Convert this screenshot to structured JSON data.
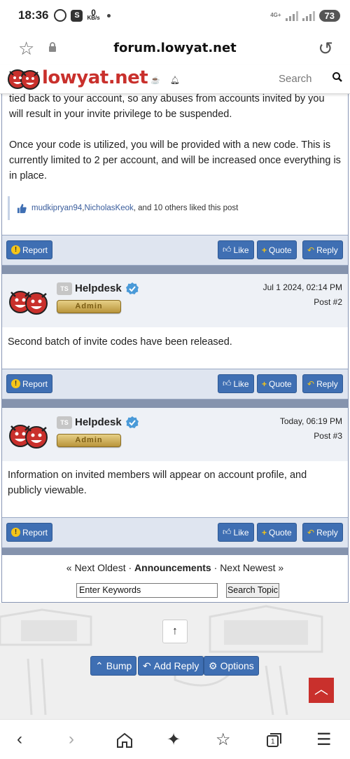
{
  "status_bar": {
    "time": "18:36",
    "kbs_value": "0",
    "kbs_unit": "KB/s",
    "network": "4G+",
    "battery": "73"
  },
  "browser": {
    "url": "forum.lowyat.net",
    "icons": [
      "star-icon",
      "lock-icon",
      "reload-icon"
    ]
  },
  "site_header": {
    "logo_text": "lowyat.net",
    "search_placeholder": "Search"
  },
  "post1_tail": {
    "paragraph1": "tied back to your account, so any abuses from accounts invited by you will result in your invite privilege to be suspended.",
    "paragraph2": "Once your code is utilized, you will be provided with a new code. This is currently limited to 2 per account, and will be increased once everything is in place.",
    "liker1": "mudkipryan94",
    "comma": ", ",
    "liker2": "NicholasKeok",
    "likes_rest": ", and 10 others liked this post"
  },
  "actions": {
    "report": "Report",
    "like": "Like",
    "quote": "Quote",
    "reply": "Reply"
  },
  "posts": [
    {
      "ts_badge": "TS",
      "author": "Helpdesk",
      "role": "Admin",
      "date": "Jul 1 2024, 02:14 PM",
      "post_number": "Post #2",
      "body": "Second batch of invite codes have been released."
    },
    {
      "ts_badge": "TS",
      "author": "Helpdesk",
      "role": "Admin",
      "date": "Today, 06:19 PM",
      "post_number": "Post #3",
      "body": "Information on invited members will appear on account profile, and publicly viewable."
    }
  ],
  "topic_nav": {
    "prev": "« Next Oldest",
    "dot1": " · ",
    "forum": "Announcements",
    "dot2": " · ",
    "next": "Next Newest »"
  },
  "topic_search": {
    "keywords_value": "Enter Keywords",
    "button": "Search Topic"
  },
  "footer_actions": {
    "bump": "Bump",
    "add_reply": "Add Reply",
    "options": "Options"
  },
  "colors": {
    "brand_red": "#c9302c",
    "button_blue": "#3f6fb3",
    "separator": "#8593ad",
    "admin_gold": "#c9a44d"
  }
}
